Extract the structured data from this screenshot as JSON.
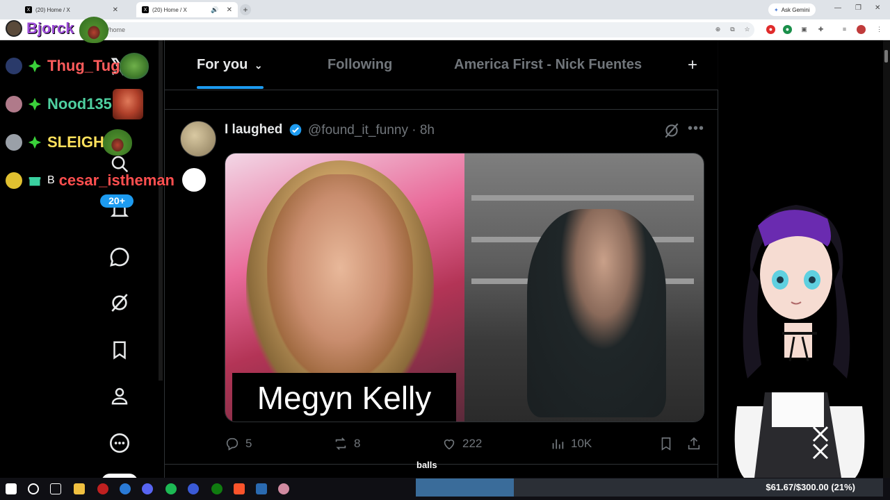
{
  "browser": {
    "tabs": [
      {
        "title": "(20) Home / X"
      },
      {
        "title": "(20) Home / X"
      }
    ],
    "gemini_label": "Ask Gemini",
    "url": "/home"
  },
  "stream_overlay": {
    "streamer_name": "Bjorck",
    "chat": [
      {
        "name": "Thug_Tug",
        "color": "#ff5c5c"
      },
      {
        "name": "Nood135",
        "color": "#4fd0a0"
      },
      {
        "name": "SLElGH",
        "color": "#ffe15c"
      },
      {
        "name": "cesar_istheman",
        "color": "#ff4f4f",
        "prefix": "B"
      }
    ],
    "goal_label": "balls",
    "goal_text": "$61.67/$300.00 (21%)",
    "goal_fraction": 0.21
  },
  "nav": {
    "notifications_badge": "20+"
  },
  "feed": {
    "tabs": [
      "For you",
      "Following",
      "America First - Nick Fuentes"
    ],
    "active_tab": "For you"
  },
  "post": {
    "display_name": "I laughed",
    "handle_time": "@found_it_funny · 8h",
    "caption": "Megyn Kelly",
    "replies": "5",
    "reposts": "8",
    "likes": "222",
    "views": "10K"
  },
  "colors": {
    "accent": "#1d9bf0",
    "muted": "#71767b",
    "text": "#e7e9ea"
  }
}
